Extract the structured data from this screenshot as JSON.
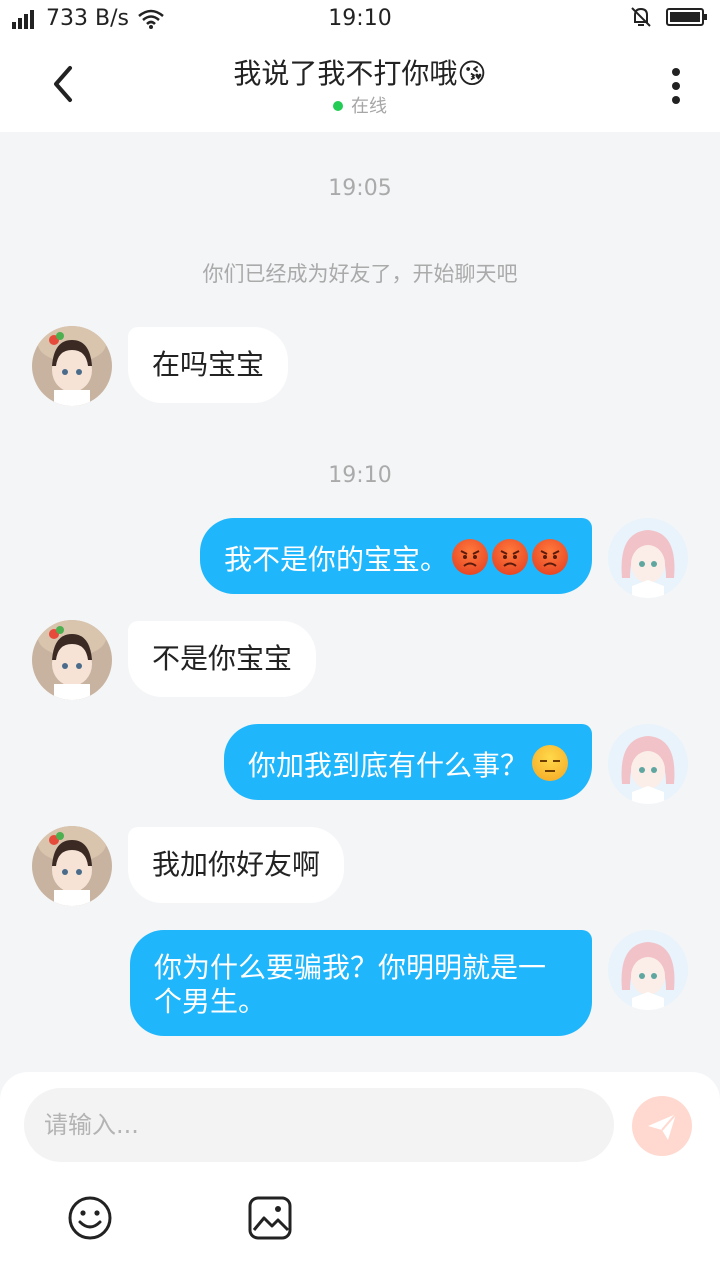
{
  "status_bar": {
    "network": "733 B/s",
    "time": "19:10"
  },
  "header": {
    "title": "我说了我不打你哦😘",
    "presence": "在线"
  },
  "messages": [
    {
      "kind": "time",
      "text": "19:05"
    },
    {
      "kind": "system",
      "text": "你们已经成为好友了，开始聊天吧"
    },
    {
      "kind": "in",
      "text": "在吗宝宝"
    },
    {
      "kind": "time",
      "text": "19:10"
    },
    {
      "kind": "out",
      "text": "我不是你的宝宝。",
      "emojis": [
        "angry-face",
        "angry-face",
        "angry-face"
      ]
    },
    {
      "kind": "in",
      "text": "不是你宝宝"
    },
    {
      "kind": "out",
      "text": "你加我到底有什么事？",
      "emojis": [
        "unamused-face"
      ]
    },
    {
      "kind": "in",
      "text": "我加你好友啊"
    },
    {
      "kind": "out",
      "text": "你为什么要骗我？你明明就是一个男生。"
    }
  ],
  "input": {
    "placeholder": "请输入..."
  },
  "icons": {
    "back": "chevron-left-icon",
    "more": "more-vertical-icon",
    "send": "send-icon",
    "emoji": "smiley-icon",
    "image": "image-icon"
  },
  "colors": {
    "outgoing_bubble": "#1fb6fb",
    "incoming_bubble": "#ffffff",
    "online_dot": "#22cc55",
    "send_button": "#ffd9cf"
  }
}
